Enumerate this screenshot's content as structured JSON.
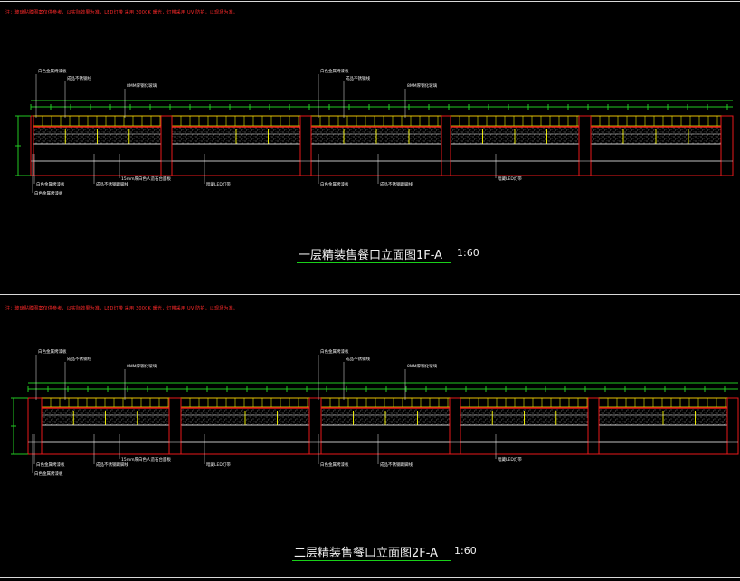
{
  "theme": {
    "background": "#000000",
    "frame": "#d8d8d8",
    "elevation_outline": "#e8191a",
    "dimension_line": "#22c922",
    "mullion": "#e8e800",
    "hatch": "#9a9a9a",
    "label_text": "#f0f0f0",
    "leader": "#e8e8e8"
  },
  "drawings": [
    {
      "id": "floor-1",
      "note": "注：玻璃贴膜图案仅供参考，以实际效果为准，LED灯带 采用 3000K 暖光，灯带采用 UV 防护，以现场为准。",
      "title": "一层精装售餐口立面图1F-A",
      "scale": "1:60",
      "labels_top": [
        "白色金属烤漆板",
        "成品不锈钢线",
        "8MM厚钢化玻璃",
        "白色金属烤漆板",
        "成品不锈钢线",
        "8MM厚钢化玻璃"
      ],
      "labels_bottom": [
        "白色金属烤漆板",
        "成品不锈钢踢脚线",
        "15mm厚白色人造石台面板",
        "暗藏LED灯带",
        "白色金属烤漆板",
        "成品不锈钢踢脚线",
        "暗藏LED灯带",
        "白色金属烤漆板"
      ]
    },
    {
      "id": "floor-2",
      "note": "注：玻璃贴膜图案仅供参考，以实际效果为准，LED灯带 采用 3000K 暖光，灯带采用 UV 防护，以现场为准。",
      "title": "二层精装售餐口立面图2F-A",
      "scale": "1:60",
      "labels_top": [
        "白色金属烤漆板",
        "成品不锈钢线",
        "8MM厚钢化玻璃",
        "白色金属烤漆板",
        "成品不锈钢线",
        "8MM厚钢化玻璃"
      ],
      "labels_bottom": [
        "白色金属烤漆板",
        "成品不锈钢踢脚线",
        "15mm厚白色人造石台面板",
        "暗藏LED灯带",
        "白色金属烤漆板",
        "成品不锈钢踢脚线",
        "暗藏LED灯带",
        "白色金属烤漆板"
      ]
    }
  ]
}
